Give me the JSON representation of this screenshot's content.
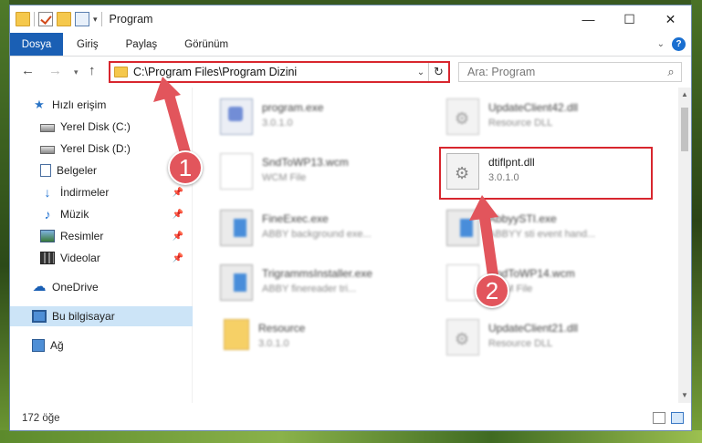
{
  "window": {
    "title": "Program"
  },
  "ribbon": {
    "tabs": [
      {
        "label": "Dosya",
        "active": true
      },
      {
        "label": "Giriş"
      },
      {
        "label": "Paylaş"
      },
      {
        "label": "Görünüm"
      }
    ]
  },
  "nav": {
    "address": "C:\\Program Files\\Program Dizini",
    "search_placeholder": "Ara: Program"
  },
  "sidebar": {
    "items": [
      {
        "label": "Hızlı erişim",
        "icon": "star-icon"
      },
      {
        "label": "Yerel Disk (C:)",
        "icon": "disk-icon",
        "pinned": true
      },
      {
        "label": "Yerel Disk (D:)",
        "icon": "disk-icon",
        "pinned": true
      },
      {
        "label": "Belgeler",
        "icon": "documents-icon",
        "pinned": true
      },
      {
        "label": "İndirmeler",
        "icon": "download-icon",
        "pinned": true
      },
      {
        "label": "Müzik",
        "icon": "music-icon",
        "pinned": true
      },
      {
        "label": "Resimler",
        "icon": "pictures-icon",
        "pinned": true
      },
      {
        "label": "Videolar",
        "icon": "videos-icon",
        "pinned": true
      },
      {
        "label": "OneDrive",
        "icon": "onedrive-icon"
      },
      {
        "label": "Bu bilgisayar",
        "icon": "computer-icon",
        "selected": true
      },
      {
        "label": "Ağ",
        "icon": "network-icon"
      }
    ]
  },
  "files": [
    {
      "name": "program.exe",
      "sub": "3.0.1.0",
      "icon": "program-icon"
    },
    {
      "name": "UpdateClient42.dll",
      "sub": "Resource DLL",
      "icon": "dll-icon"
    },
    {
      "name": "SndToWP13.wcm",
      "sub": "WCM File",
      "icon": "file-icon"
    },
    {
      "name": "dtiflpnt.dll",
      "sub": "3.0.1.0",
      "icon": "dll-icon"
    },
    {
      "name": "FineExec.exe",
      "sub": "ABBY background exe...",
      "icon": "exe-icon"
    },
    {
      "name": "AbbyySTI.exe",
      "sub": "ABBYY sti event hand...",
      "icon": "exe-icon"
    },
    {
      "name": "TrigrammsInstaller.exe",
      "sub": "ABBY finereader tri...",
      "icon": "exe-icon"
    },
    {
      "name": "SndToWP14.wcm",
      "sub": "WCM File",
      "icon": "file-icon"
    },
    {
      "name": "Resource",
      "sub": "3.0.1.0",
      "icon": "folder-icon"
    },
    {
      "name": "UpdateClient21.dll",
      "sub": "Resource DLL",
      "icon": "dll-icon"
    }
  ],
  "annotations": {
    "badge_1": "1",
    "badge_2": "2",
    "color": "#e2555c"
  },
  "status": {
    "item_count": "172 öğe"
  }
}
